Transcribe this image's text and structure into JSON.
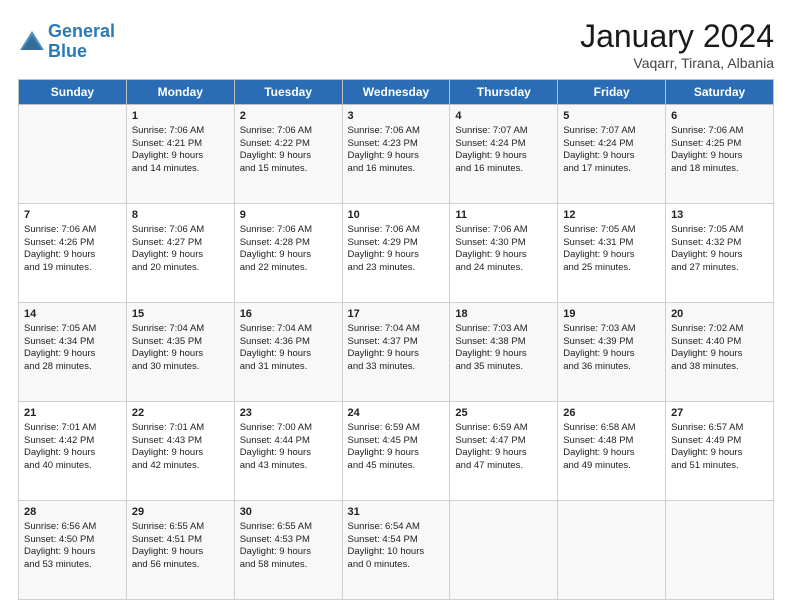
{
  "header": {
    "logo_line1": "General",
    "logo_line2": "Blue",
    "month_title": "January 2024",
    "location": "Vaqarr, Tirana, Albania"
  },
  "days_of_week": [
    "Sunday",
    "Monday",
    "Tuesday",
    "Wednesday",
    "Thursday",
    "Friday",
    "Saturday"
  ],
  "weeks": [
    [
      {
        "day": "",
        "info": ""
      },
      {
        "day": "1",
        "info": "Sunrise: 7:06 AM\nSunset: 4:21 PM\nDaylight: 9 hours\nand 14 minutes."
      },
      {
        "day": "2",
        "info": "Sunrise: 7:06 AM\nSunset: 4:22 PM\nDaylight: 9 hours\nand 15 minutes."
      },
      {
        "day": "3",
        "info": "Sunrise: 7:06 AM\nSunset: 4:23 PM\nDaylight: 9 hours\nand 16 minutes."
      },
      {
        "day": "4",
        "info": "Sunrise: 7:07 AM\nSunset: 4:24 PM\nDaylight: 9 hours\nand 16 minutes."
      },
      {
        "day": "5",
        "info": "Sunrise: 7:07 AM\nSunset: 4:24 PM\nDaylight: 9 hours\nand 17 minutes."
      },
      {
        "day": "6",
        "info": "Sunrise: 7:06 AM\nSunset: 4:25 PM\nDaylight: 9 hours\nand 18 minutes."
      }
    ],
    [
      {
        "day": "7",
        "info": "Sunrise: 7:06 AM\nSunset: 4:26 PM\nDaylight: 9 hours\nand 19 minutes."
      },
      {
        "day": "8",
        "info": "Sunrise: 7:06 AM\nSunset: 4:27 PM\nDaylight: 9 hours\nand 20 minutes."
      },
      {
        "day": "9",
        "info": "Sunrise: 7:06 AM\nSunset: 4:28 PM\nDaylight: 9 hours\nand 22 minutes."
      },
      {
        "day": "10",
        "info": "Sunrise: 7:06 AM\nSunset: 4:29 PM\nDaylight: 9 hours\nand 23 minutes."
      },
      {
        "day": "11",
        "info": "Sunrise: 7:06 AM\nSunset: 4:30 PM\nDaylight: 9 hours\nand 24 minutes."
      },
      {
        "day": "12",
        "info": "Sunrise: 7:05 AM\nSunset: 4:31 PM\nDaylight: 9 hours\nand 25 minutes."
      },
      {
        "day": "13",
        "info": "Sunrise: 7:05 AM\nSunset: 4:32 PM\nDaylight: 9 hours\nand 27 minutes."
      }
    ],
    [
      {
        "day": "14",
        "info": "Sunrise: 7:05 AM\nSunset: 4:34 PM\nDaylight: 9 hours\nand 28 minutes."
      },
      {
        "day": "15",
        "info": "Sunrise: 7:04 AM\nSunset: 4:35 PM\nDaylight: 9 hours\nand 30 minutes."
      },
      {
        "day": "16",
        "info": "Sunrise: 7:04 AM\nSunset: 4:36 PM\nDaylight: 9 hours\nand 31 minutes."
      },
      {
        "day": "17",
        "info": "Sunrise: 7:04 AM\nSunset: 4:37 PM\nDaylight: 9 hours\nand 33 minutes."
      },
      {
        "day": "18",
        "info": "Sunrise: 7:03 AM\nSunset: 4:38 PM\nDaylight: 9 hours\nand 35 minutes."
      },
      {
        "day": "19",
        "info": "Sunrise: 7:03 AM\nSunset: 4:39 PM\nDaylight: 9 hours\nand 36 minutes."
      },
      {
        "day": "20",
        "info": "Sunrise: 7:02 AM\nSunset: 4:40 PM\nDaylight: 9 hours\nand 38 minutes."
      }
    ],
    [
      {
        "day": "21",
        "info": "Sunrise: 7:01 AM\nSunset: 4:42 PM\nDaylight: 9 hours\nand 40 minutes."
      },
      {
        "day": "22",
        "info": "Sunrise: 7:01 AM\nSunset: 4:43 PM\nDaylight: 9 hours\nand 42 minutes."
      },
      {
        "day": "23",
        "info": "Sunrise: 7:00 AM\nSunset: 4:44 PM\nDaylight: 9 hours\nand 43 minutes."
      },
      {
        "day": "24",
        "info": "Sunrise: 6:59 AM\nSunset: 4:45 PM\nDaylight: 9 hours\nand 45 minutes."
      },
      {
        "day": "25",
        "info": "Sunrise: 6:59 AM\nSunset: 4:47 PM\nDaylight: 9 hours\nand 47 minutes."
      },
      {
        "day": "26",
        "info": "Sunrise: 6:58 AM\nSunset: 4:48 PM\nDaylight: 9 hours\nand 49 minutes."
      },
      {
        "day": "27",
        "info": "Sunrise: 6:57 AM\nSunset: 4:49 PM\nDaylight: 9 hours\nand 51 minutes."
      }
    ],
    [
      {
        "day": "28",
        "info": "Sunrise: 6:56 AM\nSunset: 4:50 PM\nDaylight: 9 hours\nand 53 minutes."
      },
      {
        "day": "29",
        "info": "Sunrise: 6:55 AM\nSunset: 4:51 PM\nDaylight: 9 hours\nand 56 minutes."
      },
      {
        "day": "30",
        "info": "Sunrise: 6:55 AM\nSunset: 4:53 PM\nDaylight: 9 hours\nand 58 minutes."
      },
      {
        "day": "31",
        "info": "Sunrise: 6:54 AM\nSunset: 4:54 PM\nDaylight: 10 hours\nand 0 minutes."
      },
      {
        "day": "",
        "info": ""
      },
      {
        "day": "",
        "info": ""
      },
      {
        "day": "",
        "info": ""
      }
    ]
  ]
}
